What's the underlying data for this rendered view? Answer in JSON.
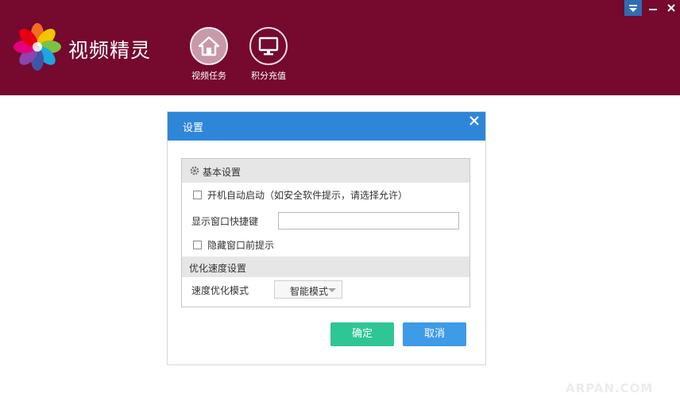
{
  "app": {
    "title": "视频精灵"
  },
  "nav": {
    "items": [
      {
        "label": "视频任务",
        "icon": "home-icon",
        "active": true
      },
      {
        "label": "积分充值",
        "icon": "monitor-icon",
        "active": false
      }
    ]
  },
  "window_controls": {
    "icons": [
      "menu-dropdown-icon",
      "minimize-icon",
      "close-icon"
    ]
  },
  "dialog": {
    "title": "设置",
    "basic_section": {
      "title": "基本设置",
      "icon": "gear-icon",
      "autostart_label": "开机自动启动（如安全软件提示，请选择允许）",
      "autostart_checked": false,
      "hotkey_label": "显示窗口快捷键",
      "hotkey_value": "",
      "hide_prompt_label": "隐藏窗口前提示",
      "hide_prompt_checked": false
    },
    "speed_section": {
      "title": "优化速度设置",
      "mode_label": "速度优化模式",
      "mode_value": "智能模式"
    },
    "ok_label": "确定",
    "cancel_label": "取消"
  },
  "colors": {
    "header_bg": "#75092e",
    "dialog_title_bg": "#2e86d9",
    "ok_bg": "#2fc695",
    "cancel_bg": "#3e9be8"
  },
  "watermark": "ARPAN.COM"
}
